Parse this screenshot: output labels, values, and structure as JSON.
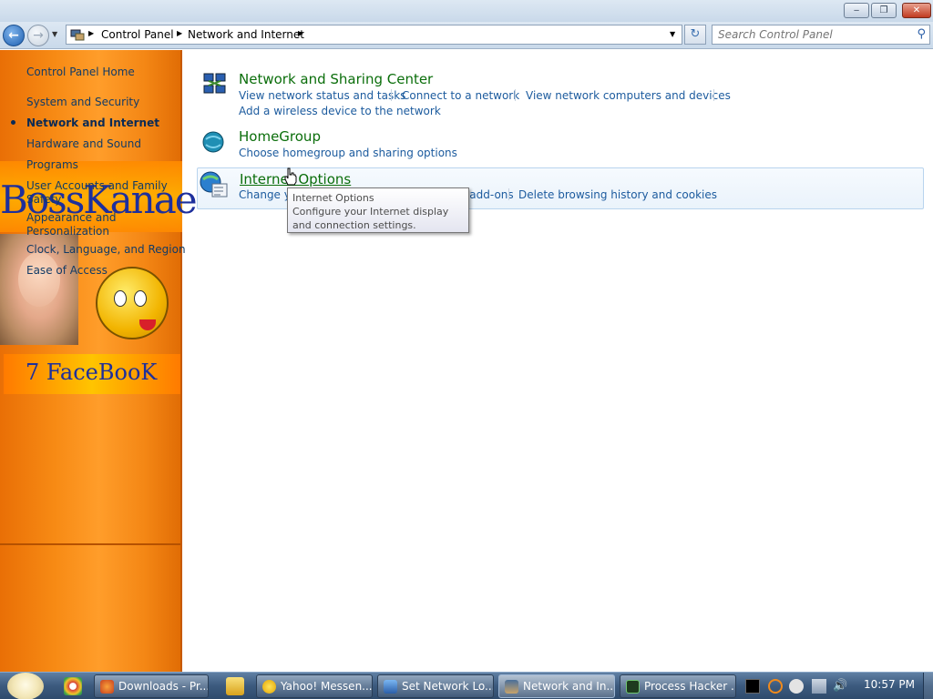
{
  "window": {
    "minimize": "‒",
    "maximize": "❐",
    "close": "✕"
  },
  "address_bar": {
    "breadcrumbs": [
      "Control Panel",
      "Network and Internet"
    ],
    "refresh_icon": "refresh-icon"
  },
  "search": {
    "placeholder": "Search Control Panel"
  },
  "sidebar": {
    "items": [
      {
        "label": "Control Panel Home"
      },
      {
        "label": "System and Security"
      },
      {
        "label": "Network and Internet",
        "current": true
      },
      {
        "label": "Hardware and Sound"
      },
      {
        "label": "Programs"
      },
      {
        "label": "User Accounts and Family Safety"
      },
      {
        "label": "Appearance and Personalization"
      },
      {
        "label": "Clock, Language, and Region"
      },
      {
        "label": "Ease of Access"
      }
    ],
    "overlay": {
      "title": "BossKanae",
      "subtitle": "7 FaceBooK"
    }
  },
  "categories": [
    {
      "title": "Network and Sharing Center",
      "links": [
        "View network status and tasks",
        "Connect to a network",
        "View network computers and devices",
        "Add a wireless device to the network"
      ]
    },
    {
      "title": "HomeGroup",
      "links": [
        "Choose homegroup and sharing options"
      ]
    },
    {
      "title": "Internet Options",
      "links": [
        "Change your homepage",
        "Manage browser add-ons",
        "Delete browsing history and cookies"
      ]
    }
  ],
  "tooltip": {
    "title": "Internet Options",
    "text": "Configure your Internet display and connection settings."
  },
  "taskbar": {
    "tasks": [
      {
        "label": "Downloads - Pr...",
        "icon": "firefox-icon"
      },
      {
        "label": "Yahoo! Messen...",
        "icon": "yahoo-messenger-icon"
      },
      {
        "label": "Set Network Lo...",
        "icon": "network-icon"
      },
      {
        "label": "Network and In...",
        "icon": "control-panel-icon",
        "active": true
      },
      {
        "label": "Process Hacker ...",
        "icon": "process-hacker-icon"
      }
    ],
    "clock": "10:57 PM"
  },
  "colors": {
    "sidebar_orange": "#f78a14",
    "category_green": "#0b6e0b",
    "link_blue": "#1c5b9e"
  }
}
